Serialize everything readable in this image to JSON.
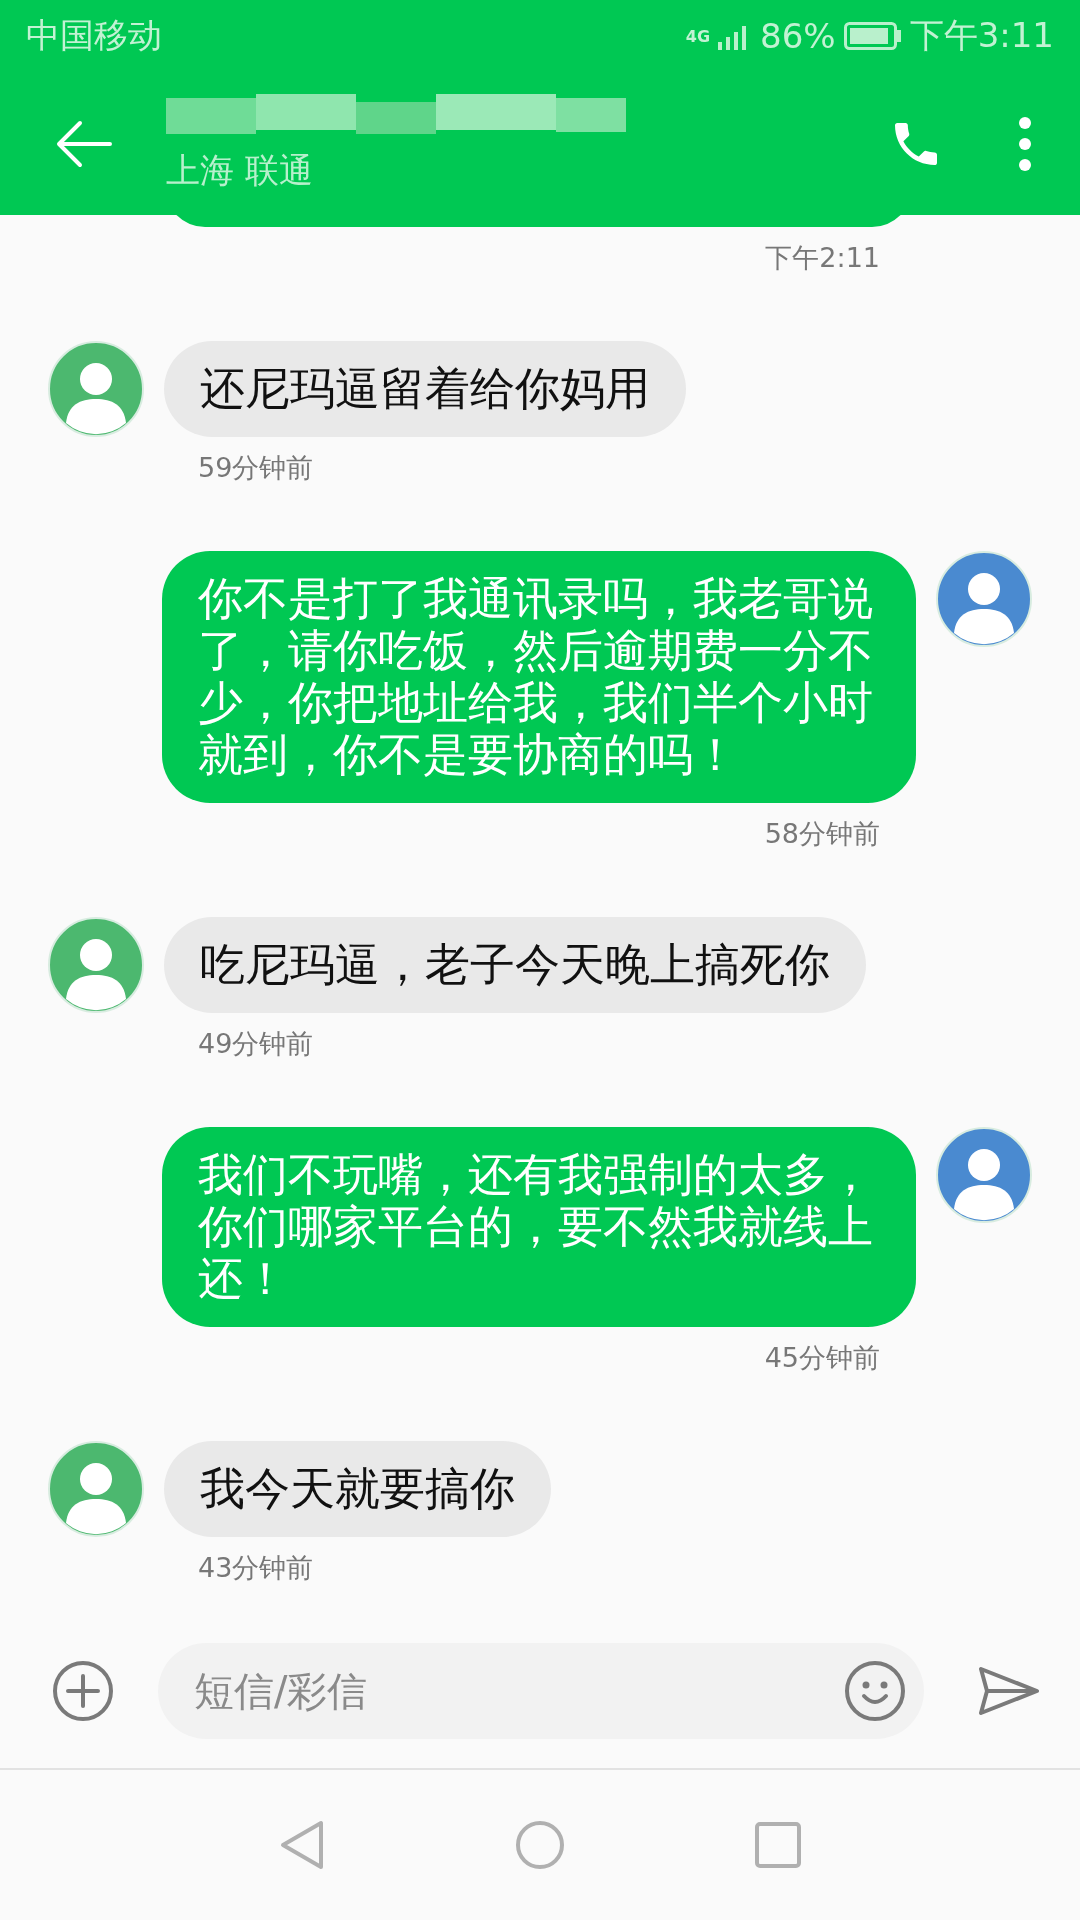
{
  "status_bar": {
    "carrier": "中国移动",
    "network": "4G",
    "battery": "86%",
    "time": "下午3:11"
  },
  "header": {
    "subtitle": "上海 联通"
  },
  "first_time": "下午2:11",
  "messages": [
    {
      "kind": "incoming",
      "text": "还尼玛逼留着给你妈用",
      "time": "59分钟前"
    },
    {
      "kind": "outgoing",
      "text": "你不是打了我通讯录吗，我老哥说了，请你吃饭，然后逾期费一分不少，你把地址给我，我们半个小时就到，你不是要协商的吗！",
      "time": "58分钟前"
    },
    {
      "kind": "incoming",
      "text": "吃尼玛逼，老子今天晚上搞死你",
      "time": "49分钟前"
    },
    {
      "kind": "outgoing",
      "text": "我们不玩嘴，还有我强制的太多，你们哪家平台的，要不然我就线上还！",
      "time": "45分钟前"
    },
    {
      "kind": "incoming",
      "text": "我今天就要搞你",
      "time": "43分钟前"
    }
  ],
  "composer": {
    "placeholder": "短信/彩信"
  }
}
